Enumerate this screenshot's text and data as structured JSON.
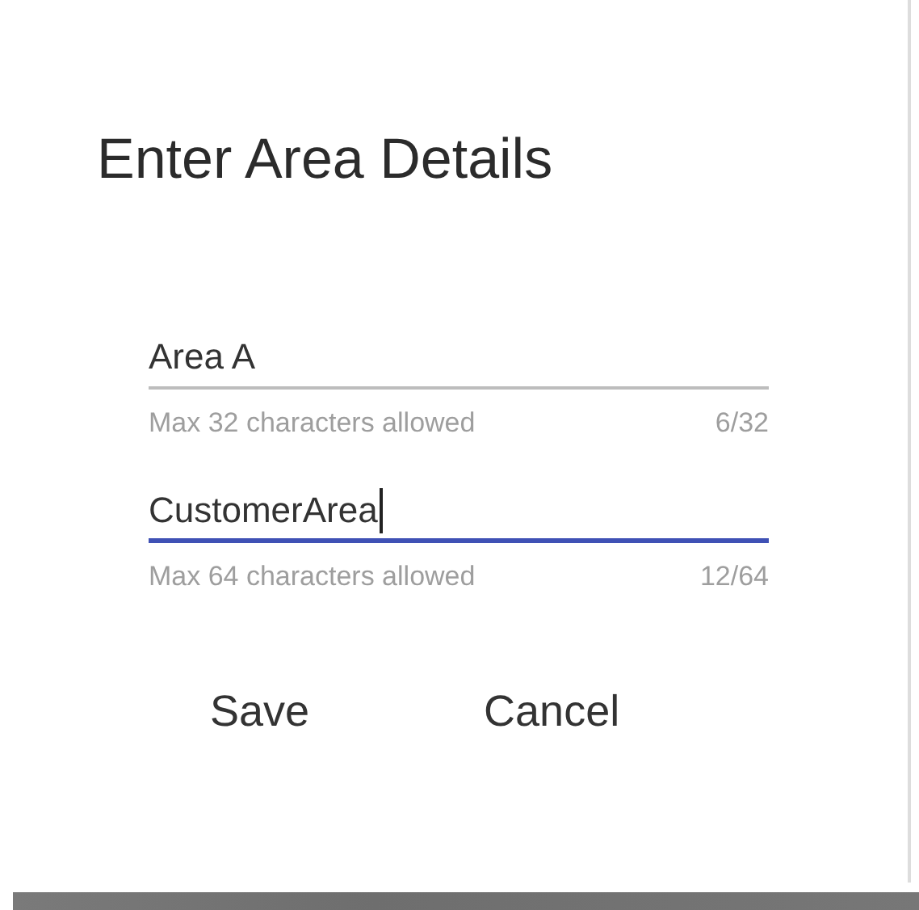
{
  "dialog": {
    "title": "Enter Area Details",
    "fields": [
      {
        "value": "Area A",
        "focused": false,
        "hint": "Max 32 characters allowed",
        "counter": "6/32"
      },
      {
        "value": "CustomerArea",
        "focused": true,
        "hint": "Max 64 characters allowed",
        "counter": "12/64"
      }
    ],
    "buttons": [
      "Save",
      "Cancel"
    ]
  }
}
